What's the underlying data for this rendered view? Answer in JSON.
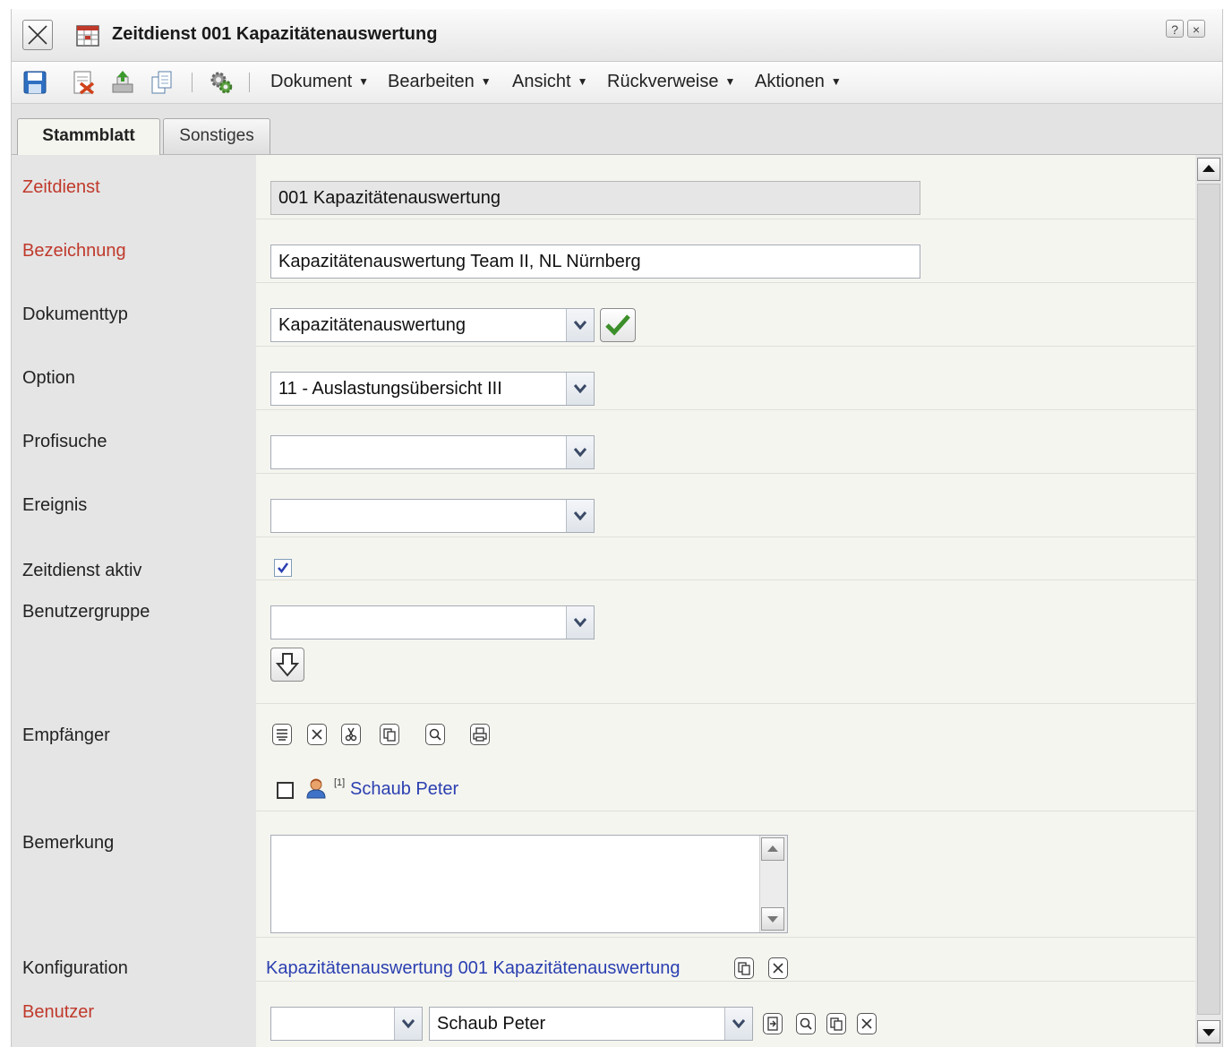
{
  "window": {
    "title": "Zeitdienst 001 Kapazitätenauswertung",
    "help_label": "?",
    "close_label": "×"
  },
  "toolbar": {
    "icons": [
      "save-icon",
      "delete-icon",
      "export-icon",
      "copy-icon",
      "settings-icon"
    ],
    "menus": [
      "Dokument",
      "Bearbeiten",
      "Ansicht",
      "Rückverweise",
      "Aktionen"
    ]
  },
  "tabs": [
    {
      "label": "Stammblatt",
      "active": true
    },
    {
      "label": "Sonstiges",
      "active": false
    }
  ],
  "form": {
    "zeitdienst": {
      "label": "Zeitdienst",
      "value": "001 Kapazitätenauswertung"
    },
    "bezeichnung": {
      "label": "Bezeichnung",
      "value": "Kapazitätenauswertung Team II, NL Nürnberg"
    },
    "dokumenttyp": {
      "label": "Dokumenttyp",
      "value": "Kapazitätenauswertung"
    },
    "option": {
      "label": "Option",
      "value": "11 - Auslastungsübersicht III"
    },
    "profisuche": {
      "label": "Profisuche",
      "value": ""
    },
    "ereignis": {
      "label": "Ereignis",
      "value": ""
    },
    "zeitdienst_aktiv": {
      "label": "Zeitdienst aktiv",
      "checked": true
    },
    "benutzergruppe": {
      "label": "Benutzergruppe",
      "value": ""
    },
    "empfaenger": {
      "label": "Empfänger",
      "tools": [
        "list-icon",
        "remove-icon",
        "cut-icon",
        "copy-icon",
        "search-icon",
        "print-icon"
      ],
      "recipients": [
        {
          "index": "[1]",
          "name": "Schaub Peter"
        }
      ]
    },
    "bemerkung": {
      "label": "Bemerkung",
      "value": ""
    },
    "konfiguration": {
      "label": "Konfiguration",
      "value": "Kapazitätenauswertung 001 Kapazitätenauswertung"
    },
    "benutzer": {
      "label": "Benutzer",
      "group_value": "",
      "user_value": "Schaub Peter"
    }
  },
  "colors": {
    "required_label": "#c0392b",
    "link": "#2a3fb0",
    "label_column": "#e5e5e5",
    "content_background": "#f5f5f0"
  }
}
